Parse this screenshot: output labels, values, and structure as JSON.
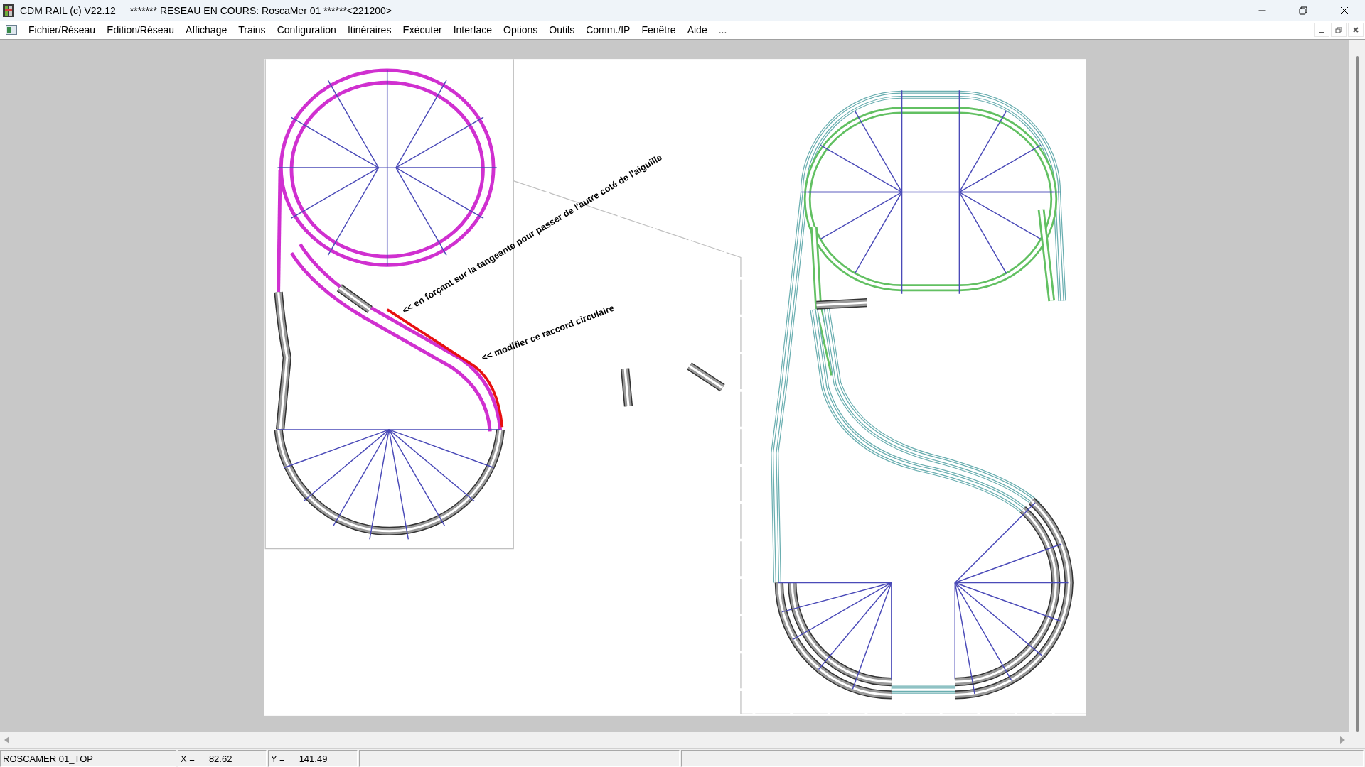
{
  "window": {
    "title": "CDM RAIL (c) V22.12",
    "subtitle": "******* RESEAU EN COURS: RoscaMer 01 ******<221200>"
  },
  "menu": [
    "Fichier/Réseau",
    "Edition/Réseau",
    "Affichage",
    "Trains",
    "Configuration",
    "Itinéraires",
    "Exécuter",
    "Interface",
    "Options",
    "Outils",
    "Comm./IP",
    "Fenêtre",
    "Aide",
    "..."
  ],
  "canvas": {
    "annotations": [
      {
        "text": "<< en forçant sur la tangeante pour passer de l'autre coté de l'aiguille"
      },
      {
        "text": "<< modifier ce raccord circulaire"
      }
    ]
  },
  "status_bar": {
    "layer": "ROSCAMER 01_TOP",
    "x_label": "X =",
    "x_value": "82.62",
    "y_label": "Y =",
    "y_value": "141.49"
  }
}
